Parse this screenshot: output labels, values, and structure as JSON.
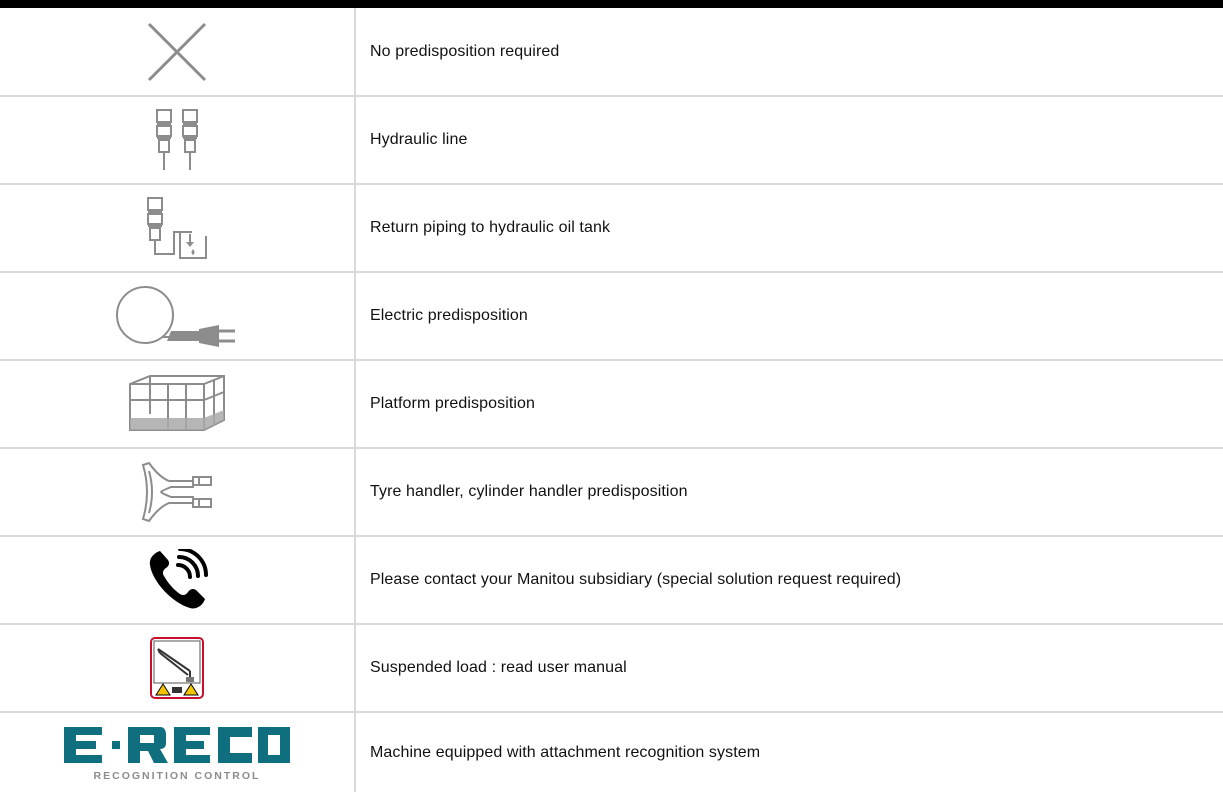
{
  "legend": {
    "rows": [
      {
        "icon": "cross-icon",
        "description": "No predisposition required"
      },
      {
        "icon": "hydraulic-line-icon",
        "description": "Hydraulic line"
      },
      {
        "icon": "return-piping-tank-icon",
        "description": "Return piping to hydraulic oil tank"
      },
      {
        "icon": "electric-plug-icon",
        "description": "Electric predisposition"
      },
      {
        "icon": "platform-icon",
        "description": "Platform predisposition"
      },
      {
        "icon": "tyre-handler-icon",
        "description": "Tyre handler, cylinder handler predisposition"
      },
      {
        "icon": "phone-icon",
        "description": "Please contact your Manitou subsidiary (special solution request required)"
      },
      {
        "icon": "suspended-load-warning-icon",
        "description": "Suspended load : read user manual"
      },
      {
        "icon": "ereco-logo",
        "description": "Machine equipped with attachment recognition system"
      }
    ]
  },
  "logo": {
    "wordmark": "E·RECO",
    "tagline": "RECOGNITION CONTROL"
  },
  "colors": {
    "icon_gray": "#8c8c8c",
    "logo_teal": "#0f6f7f",
    "warning_red": "#c8102e",
    "warning_yellow": "#f5c400",
    "border": "#d9d9d9"
  }
}
